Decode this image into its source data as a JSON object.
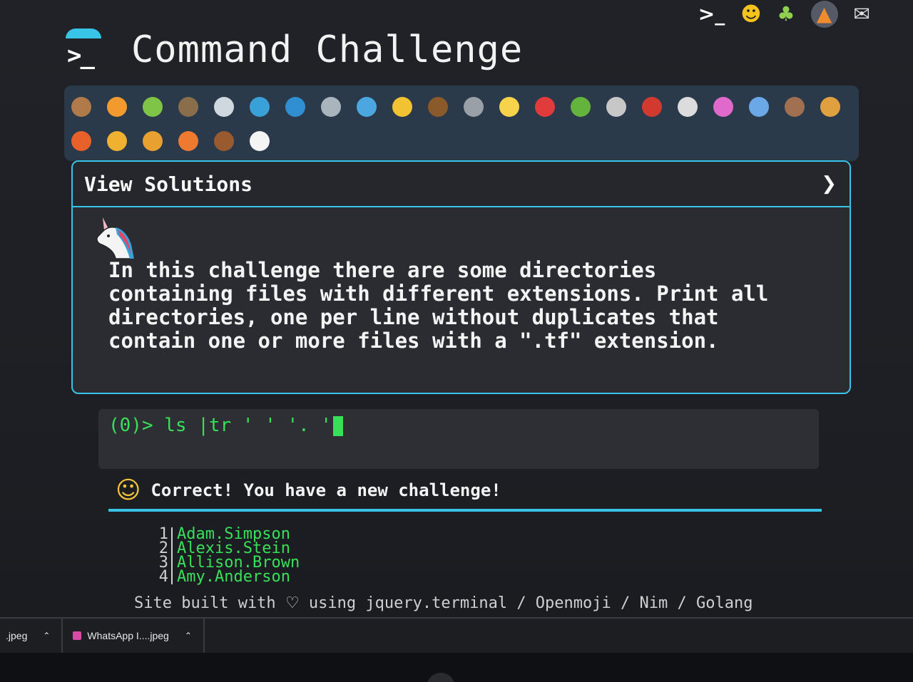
{
  "app": {
    "title": "Command Challenge",
    "logo_icon": "terminal-prompt-icon",
    "accent_color": "#37c4e6"
  },
  "top_nav": {
    "icons": [
      "terminal-icon",
      "shushing-face-icon",
      "tree-icon",
      "gitlab-fox-icon",
      "mail-icon"
    ]
  },
  "animal_bar": {
    "row1": [
      "snail-icon",
      "butterfly-icon",
      "caterpillar-icon",
      "ant-icon",
      "spider-web-icon",
      "whale-icon",
      "dolphin-icon",
      "shark-icon",
      "fish-icon",
      "tropical-fish-icon",
      "hedgehog-icon",
      "wolf-icon",
      "bee-icon",
      "ladybug-icon",
      "cricket-icon",
      "spider-icon",
      "scorpion-icon",
      "fly-icon",
      "worm-icon",
      "microbe-icon",
      "monkey-icon",
      "dog-icon"
    ],
    "row2": [
      "fox-icon",
      "cat-icon",
      "lion-icon",
      "tiger-icon",
      "horse-icon",
      "unicorn-icon"
    ]
  },
  "solutions": {
    "header_label": "View Solutions",
    "chevron": "❯",
    "challenge_text": "In this challenge there are some directories containing files with different extensions. Print all directories, one per line without duplicates that contain one or more files with a \".tf\" extension."
  },
  "terminal": {
    "prompt": "(0)> ",
    "command": "ls |tr ' ' '. '"
  },
  "result": {
    "message": "Correct! You have a new challenge!",
    "icon": "genie-icon"
  },
  "output": {
    "lines": [
      {
        "num": "1",
        "text": "Adam.Simpson"
      },
      {
        "num": "2",
        "text": "Alexis.Stein"
      },
      {
        "num": "3",
        "text": "Allison.Brown"
      },
      {
        "num": "4",
        "text": "Amy.Anderson"
      }
    ]
  },
  "footer": {
    "prefix": "Site built with",
    "heart": "♡",
    "suffix": "using jquery.terminal / Openmoji / Nim / Golang"
  },
  "downloads": {
    "items": [
      {
        "name": ".jpeg"
      },
      {
        "name": "WhatsApp I....jpeg"
      }
    ]
  }
}
